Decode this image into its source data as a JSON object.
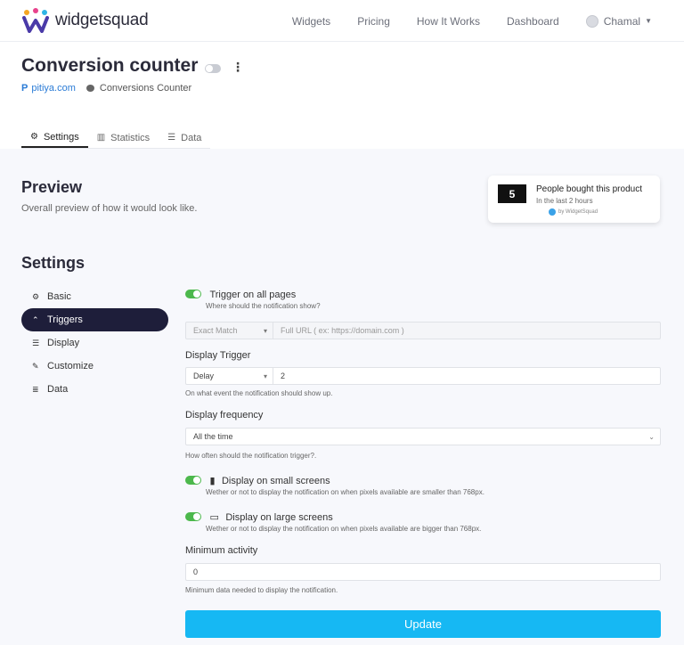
{
  "brand": {
    "name": "widgetsquad",
    "accent": "#16b8f3"
  },
  "nav": {
    "items": [
      "Widgets",
      "Pricing",
      "How It Works",
      "Dashboard"
    ],
    "user": "Chamal"
  },
  "header": {
    "title": "Conversion counter",
    "site": "pitiya.com",
    "widget_type": "Conversions Counter",
    "tabs": [
      "Settings",
      "Statistics",
      "Data"
    ]
  },
  "preview": {
    "title": "Preview",
    "subtitle": "Overall preview of how it would look like.",
    "notification": {
      "count": "5",
      "line1": "People bought this product",
      "line2": "In the last 2 hours",
      "byline": "by WidgetSquad"
    }
  },
  "settings": {
    "title": "Settings",
    "menu": [
      "Basic",
      "Triggers",
      "Display",
      "Customize",
      "Data"
    ],
    "active_menu": "Triggers"
  },
  "form": {
    "trigger_all_label": "Trigger on all pages",
    "trigger_all_help": "Where should the notification show?",
    "match_select": "Exact Match",
    "url_placeholder": "Full URL ( ex: https://domain.com )",
    "display_trigger_label": "Display Trigger",
    "display_trigger_select": "Delay",
    "display_trigger_value": "2",
    "display_trigger_help": "On what event the notification should show up.",
    "frequency_label": "Display frequency",
    "frequency_select": "All the time",
    "frequency_help": "How often should the notification trigger?.",
    "small_label": "Display on small screens",
    "small_help": "Wether or not to display the notification on when pixels available are smaller than 768px.",
    "large_label": "Display on large screens",
    "large_help": "Wether or not to display the notification on when pixels available are bigger than 768px.",
    "min_activity_label": "Minimum activity",
    "min_activity_value": "0",
    "min_activity_help": "Minimum data needed to display the notification.",
    "update_label": "Update"
  }
}
